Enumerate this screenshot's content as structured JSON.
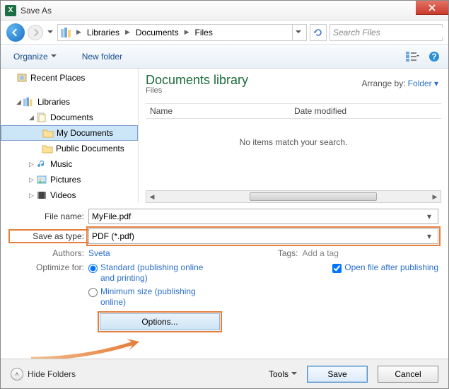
{
  "window": {
    "title": "Save As"
  },
  "breadcrumb": {
    "root": "",
    "items": [
      "Libraries",
      "Documents",
      "Files"
    ]
  },
  "search": {
    "placeholder": "Search Files"
  },
  "toolbar": {
    "organize": "Organize",
    "new_folder": "New folder"
  },
  "sidebar": {
    "recent": "Recent Places",
    "libraries": "Libraries",
    "documents": "Documents",
    "my_documents": "My Documents",
    "public_documents": "Public Documents",
    "music": "Music",
    "pictures": "Pictures",
    "videos": "Videos"
  },
  "content": {
    "library_title": "Documents library",
    "library_sub": "Files",
    "arrange_label": "Arrange by:",
    "arrange_value": "Folder",
    "col_name": "Name",
    "col_date": "Date modified",
    "empty": "No items match your search."
  },
  "form": {
    "filename_label": "File name:",
    "filename_value": "MyFile.pdf",
    "saveastype_label": "Save as type:",
    "saveastype_value": "PDF (*.pdf)",
    "authors_label": "Authors:",
    "authors_value": "Sveta",
    "tags_label": "Tags:",
    "tags_value": "Add a tag",
    "optimize_label": "Optimize for:",
    "optimize_standard": "Standard (publishing online and printing)",
    "optimize_minimum": "Minimum size (publishing online)",
    "open_after": "Open file after publishing",
    "options_btn": "Options..."
  },
  "footer": {
    "hide_folders": "Hide Folders",
    "tools": "Tools",
    "save": "Save",
    "cancel": "Cancel"
  }
}
